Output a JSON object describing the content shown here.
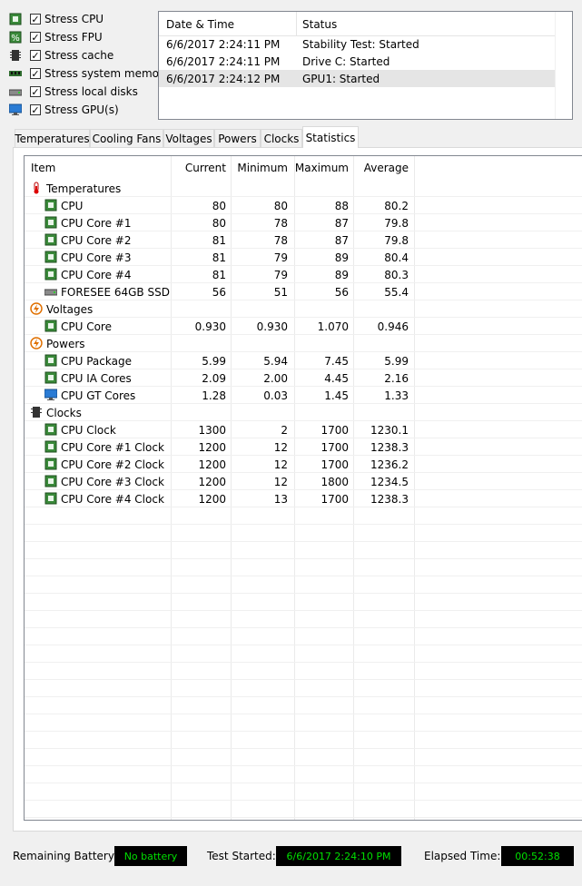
{
  "stress_options": [
    {
      "label": "Stress CPU",
      "checked": true,
      "icon": "cpu-chip-icon"
    },
    {
      "label": "Stress FPU",
      "checked": true,
      "icon": "fpu-percent-icon"
    },
    {
      "label": "Stress cache",
      "checked": true,
      "icon": "cache-icon"
    },
    {
      "label": "Stress system memory",
      "checked": true,
      "icon": "memory-module-icon"
    },
    {
      "label": "Stress local disks",
      "checked": true,
      "icon": "disk-drive-icon"
    },
    {
      "label": "Stress GPU(s)",
      "checked": true,
      "icon": "monitor-icon"
    }
  ],
  "log": {
    "headers": {
      "datetime": "Date & Time",
      "status": "Status"
    },
    "rows": [
      {
        "datetime": "6/6/2017 2:24:11 PM",
        "status": "Stability Test: Started"
      },
      {
        "datetime": "6/6/2017 2:24:11 PM",
        "status": "Drive C: Started"
      },
      {
        "datetime": "6/6/2017 2:24:12 PM",
        "status": "GPU1: Started"
      }
    ]
  },
  "tabs": [
    "Temperatures",
    "Cooling Fans",
    "Voltages",
    "Powers",
    "Clocks",
    "Statistics"
  ],
  "active_tab": "Statistics",
  "stats": {
    "headers": {
      "item": "Item",
      "current": "Current",
      "minimum": "Minimum",
      "maximum": "Maximum",
      "average": "Average"
    },
    "rows": [
      {
        "group": true,
        "label": "Temperatures",
        "icon": "thermometer-icon"
      },
      {
        "label": "CPU",
        "current": "80",
        "minimum": "80",
        "maximum": "88",
        "average": "80.2",
        "icon": "cpu-chip-icon"
      },
      {
        "label": "CPU Core #1",
        "current": "80",
        "minimum": "78",
        "maximum": "87",
        "average": "79.8",
        "icon": "cpu-chip-icon"
      },
      {
        "label": "CPU Core #2",
        "current": "81",
        "minimum": "78",
        "maximum": "87",
        "average": "79.8",
        "icon": "cpu-chip-icon"
      },
      {
        "label": "CPU Core #3",
        "current": "81",
        "minimum": "79",
        "maximum": "89",
        "average": "80.4",
        "icon": "cpu-chip-icon"
      },
      {
        "label": "CPU Core #4",
        "current": "81",
        "minimum": "79",
        "maximum": "89",
        "average": "80.3",
        "icon": "cpu-chip-icon"
      },
      {
        "label": "FORESEE 64GB SSD",
        "current": "56",
        "minimum": "51",
        "maximum": "56",
        "average": "55.4",
        "icon": "disk-drive-icon"
      },
      {
        "group": true,
        "label": "Voltages",
        "icon": "voltage-icon"
      },
      {
        "label": "CPU Core",
        "current": "0.930",
        "minimum": "0.930",
        "maximum": "1.070",
        "average": "0.946",
        "icon": "cpu-chip-icon"
      },
      {
        "group": true,
        "label": "Powers",
        "icon": "power-icon"
      },
      {
        "label": "CPU Package",
        "current": "5.99",
        "minimum": "5.94",
        "maximum": "7.45",
        "average": "5.99",
        "icon": "cpu-chip-icon"
      },
      {
        "label": "CPU IA Cores",
        "current": "2.09",
        "minimum": "2.00",
        "maximum": "4.45",
        "average": "2.16",
        "icon": "cpu-chip-icon"
      },
      {
        "label": "CPU GT Cores",
        "current": "1.28",
        "minimum": "0.03",
        "maximum": "1.45",
        "average": "1.33",
        "icon": "monitor-icon"
      },
      {
        "group": true,
        "label": "Clocks",
        "icon": "clock-chip-icon"
      },
      {
        "label": "CPU Clock",
        "current": "1300",
        "minimum": "2",
        "maximum": "1700",
        "average": "1230.1",
        "icon": "cpu-chip-icon"
      },
      {
        "label": "CPU Core #1 Clock",
        "current": "1200",
        "minimum": "12",
        "maximum": "1700",
        "average": "1238.3",
        "icon": "cpu-chip-icon"
      },
      {
        "label": "CPU Core #2 Clock",
        "current": "1200",
        "minimum": "12",
        "maximum": "1700",
        "average": "1236.2",
        "icon": "cpu-chip-icon"
      },
      {
        "label": "CPU Core #3 Clock",
        "current": "1200",
        "minimum": "12",
        "maximum": "1800",
        "average": "1234.5",
        "icon": "cpu-chip-icon"
      },
      {
        "label": "CPU Core #4 Clock",
        "current": "1200",
        "minimum": "13",
        "maximum": "1700",
        "average": "1238.3",
        "icon": "cpu-chip-icon"
      }
    ]
  },
  "footer": {
    "battery_label": "Remaining Battery:",
    "battery_value": "No battery",
    "started_label": "Test Started:",
    "started_value": "6/6/2017 2:24:10 PM",
    "elapsed_label": "Elapsed Time:",
    "elapsed_value": "00:52:38"
  },
  "colors": {
    "lcd_text": "#00e000",
    "lcd_bg": "#000000",
    "chip_green": "#3a8a3a",
    "selection": "#e5e5e5"
  }
}
